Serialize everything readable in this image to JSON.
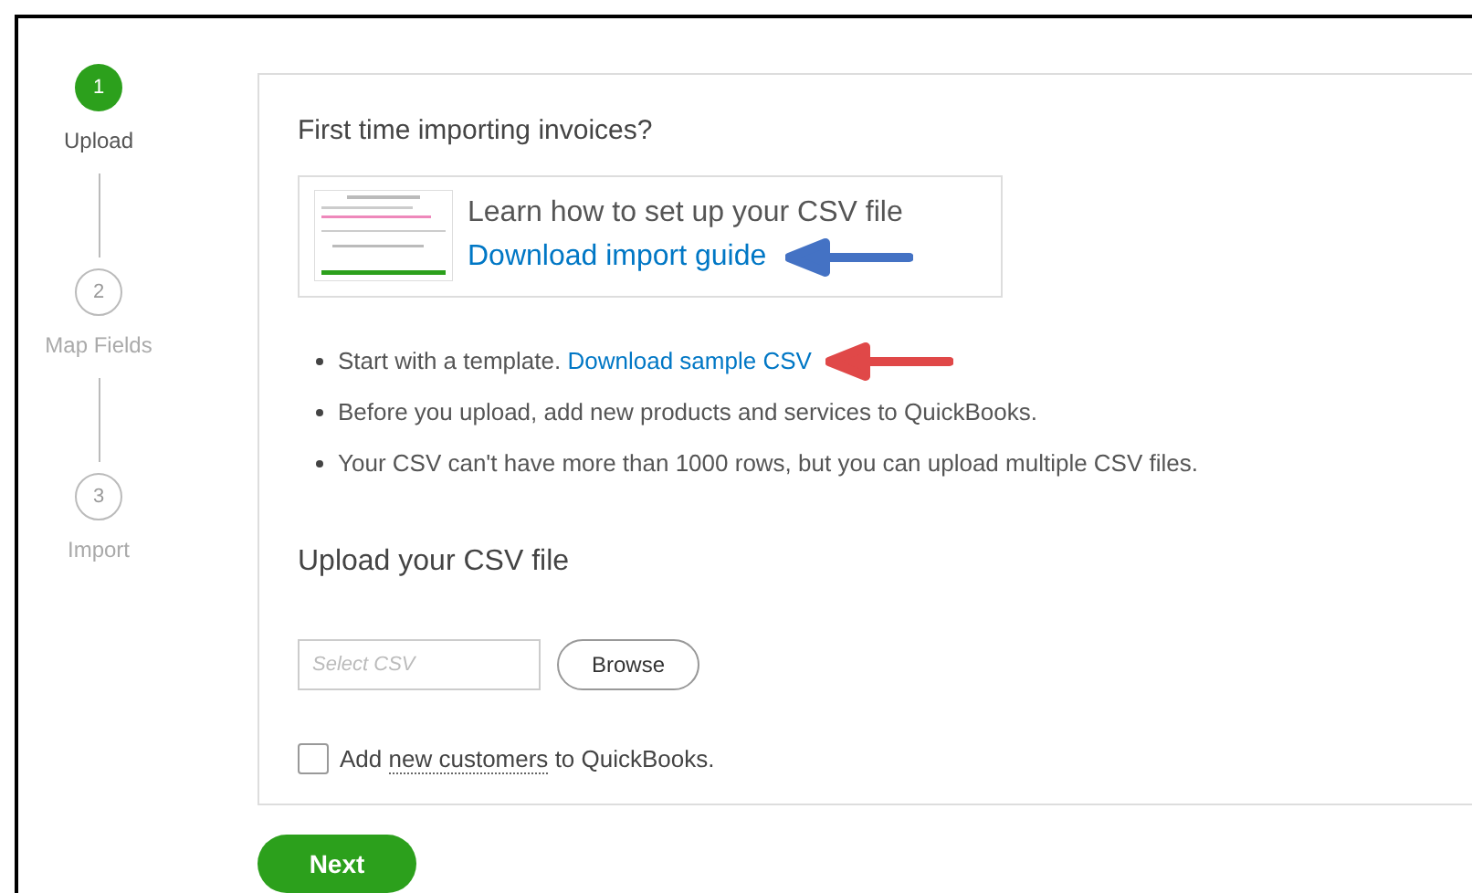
{
  "steps": [
    {
      "number": "1",
      "label": "Upload",
      "selected": true
    },
    {
      "number": "2",
      "label": "Map Fields",
      "selected": false
    },
    {
      "number": "3",
      "label": "Import",
      "selected": false
    }
  ],
  "intro": {
    "title": "First time importing invoices?",
    "guide_text": "Learn how to set up your CSV file",
    "guide_link": "Download import guide"
  },
  "tips": [
    {
      "text": "Start with a template.",
      "link": "Download sample CSV"
    },
    {
      "text": "Before you upload, add new products and services to QuickBooks."
    },
    {
      "text": "Your CSV can't have more than 1000 rows, but you can upload multiple CSV files."
    }
  ],
  "upload": {
    "title": "Upload your CSV file",
    "placeholder": "Select CSV",
    "browse": "Browse"
  },
  "option": {
    "checked": false,
    "before": "Add",
    "link": "new customers",
    "after": "to QuickBooks."
  },
  "next": "Next"
}
